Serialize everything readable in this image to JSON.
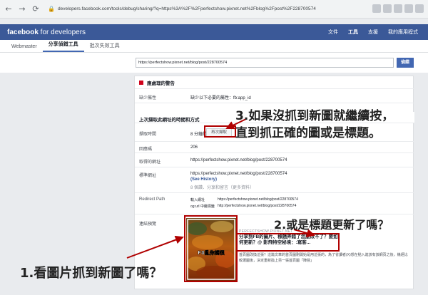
{
  "browser": {
    "url": "developers.facebook.com/tools/debug/sharing/?q=https%3A%2F%2Fperfectshow.pixnet.net%2Fblog%2Fpost%2F228700574"
  },
  "header": {
    "logo_bold": "facebook",
    "logo_rest": " for developers",
    "nav": [
      "文件",
      "工具",
      "支援",
      "我的應用程式"
    ]
  },
  "tabs": [
    "Webmaster",
    "分享偵錯工具",
    "批次失效工具"
  ],
  "input": {
    "value": "https://perfectshow.pixnet.net/blog/post/228700574",
    "button": "偵錯"
  },
  "warnings": {
    "title": "應處理的警告",
    "row_label": "缺少屬性",
    "row_value": "缺少以下必要的屬性：fb:app_id"
  },
  "section": {
    "title": "上次擷取此網址的時間和方式",
    "fetch_label": "擷取時間",
    "fetch_value": "8 分鐘前",
    "rescrape": "再次擷取",
    "response_label": "回應碼",
    "response_value": "206",
    "fetched_url_label": "取得的網址",
    "fetched_url_value": "https://perfectshow.pixnet.net/blog/post/228700574",
    "canonical_label": "標準網址",
    "canonical_value": "https://perfectshow.pixnet.net/blog/post/228700574",
    "canonical_see_history": "(See History)",
    "canonical_likes": "8 個讚、分享和留言（更多資料）",
    "redirect_label": "Redirect Path",
    "redirect_input_label": "輸入網址",
    "redirect_input_value": "https://perfectshow.pixnet.net/blog/post/228700574",
    "redirect_og_label": "og:url 中繼標籤",
    "redirect_og_value": "http://perfectshow.pixnet.net/blog/post/228700574",
    "preview_label": "連結預覽"
  },
  "preview": {
    "image_caption": "F8亂你媽很",
    "site": "PERFECTSHOW.PIXNET.NET",
    "title": "分享到FB的圖片、標題弄錯了怎麼改不了？要如何更新？@ 影飛特空秘境：:寫客...",
    "description": "首頁圖改換這張？這篇文章的首頁圖剛開始是用這張的，為了省讀者(X)想在點入進該有該網頁之後，幾經比較選圖後，決定重新換上另一張首頁圖「陣營」"
  },
  "annotations": {
    "note3_line1": "3.如果沒抓到新圖就繼續按，",
    "note3_line2": "直到抓正確的圖或是標題。",
    "note2": "2.或是標題更新了嗎？",
    "note1": "1.看圖片抓到新圖了嗎？",
    "accent": "#b00000"
  },
  "colors": {
    "fb_blue": "#3b5998",
    "button_blue": "#4267b2",
    "link_blue": "#365899"
  }
}
